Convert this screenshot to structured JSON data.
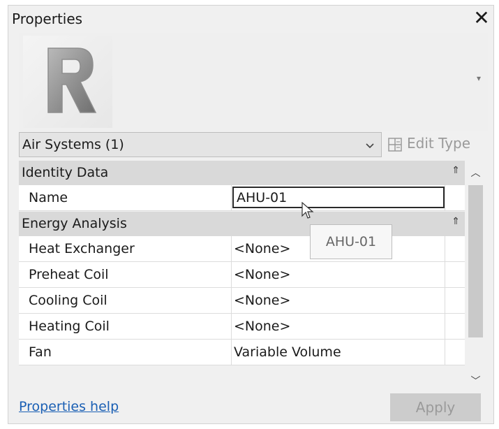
{
  "window": {
    "title": "Properties",
    "close_glyph": "✕"
  },
  "type_selector": {
    "image_icon": "revit-family-icon",
    "preview_arrow_glyph": "▾"
  },
  "type_combo": {
    "value": "Air Systems (1)",
    "chevron_icon": "chevron-down-icon"
  },
  "edit_type": {
    "label": "Edit Type",
    "icon": "edit-type-icon"
  },
  "groups": [
    {
      "label": "Identity Data",
      "rows": [
        {
          "label": "Name",
          "value": "AHU-01",
          "editing": true
        }
      ]
    },
    {
      "label": "Energy Analysis",
      "rows": [
        {
          "label": "Heat Exchanger",
          "value": "<None>"
        },
        {
          "label": "Preheat Coil",
          "value": "<None>"
        },
        {
          "label": "Cooling Coil",
          "value": "<None>"
        },
        {
          "label": "Heating Coil",
          "value": "<None>"
        },
        {
          "label": "Fan",
          "value": "Variable Volume"
        }
      ]
    }
  ],
  "collapse_glyph": "⇑",
  "tooltip": {
    "text": "AHU-01"
  },
  "scrollbar": {
    "up_glyph": "︿",
    "down_glyph": "﹀"
  },
  "footer": {
    "help_link": "Properties help",
    "apply_label": "Apply"
  }
}
